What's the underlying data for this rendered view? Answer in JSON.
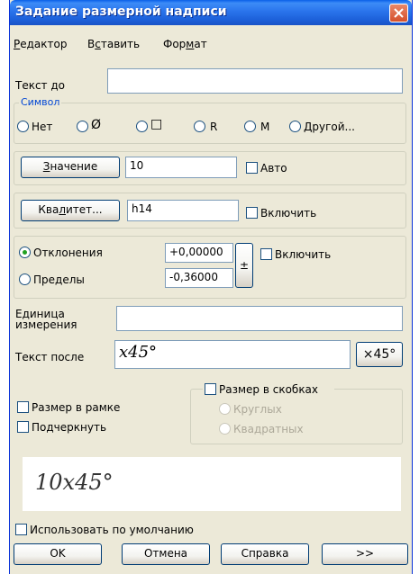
{
  "window": {
    "title": "Задание размерной надписи"
  },
  "menu": {
    "editor_pre": "",
    "editor_ul": "Р",
    "editor_post": "едактор",
    "insert_pre": "В",
    "insert_ul": "с",
    "insert_post": "тавить",
    "format_pre": "Фор",
    "format_ul": "м",
    "format_post": "ат"
  },
  "text_before": {
    "label": "Текст до",
    "value": ""
  },
  "symbol": {
    "title": "Символ",
    "options": [
      {
        "label": "Нет",
        "glyph": ""
      },
      {
        "label": "",
        "glyph": "Ø"
      },
      {
        "label": "",
        "glyph": "□"
      },
      {
        "label": "R",
        "glyph": ""
      },
      {
        "label": "M",
        "glyph": ""
      },
      {
        "label": "Другой...",
        "glyph": ""
      }
    ]
  },
  "value": {
    "button_ul": "З",
    "button_rest": "начение",
    "value": "10",
    "auto_label": "Авто"
  },
  "tolerance_class": {
    "button_pre": "Ква",
    "button_ul": "л",
    "button_post": "итет...",
    "value": "h14",
    "enable_label": "Включить"
  },
  "deviations": {
    "deviations_label": "Отклонения",
    "limits_label": "Пределы",
    "upper": "+0,00000",
    "lower": "-0,36000",
    "pm_glyph": "±",
    "enable_label": "Включить"
  },
  "unit": {
    "label_line1": "Единица",
    "label_line2": "измерения",
    "value": ""
  },
  "text_after": {
    "label": "Текст после",
    "value": "x45°",
    "button_label": "×45°"
  },
  "options": {
    "framed_label": "Размер в рамке",
    "underline_label": "Подчеркнуть",
    "brackets_label": "Размер в скобках",
    "round_label": "Круглых",
    "square_label": "Квадратных"
  },
  "preview": {
    "text": "10x45°"
  },
  "use_default_label": "Использовать по умолчанию",
  "buttons": {
    "ok": "OK",
    "cancel": "Отмена",
    "help": "Справка",
    "more": ">>"
  }
}
